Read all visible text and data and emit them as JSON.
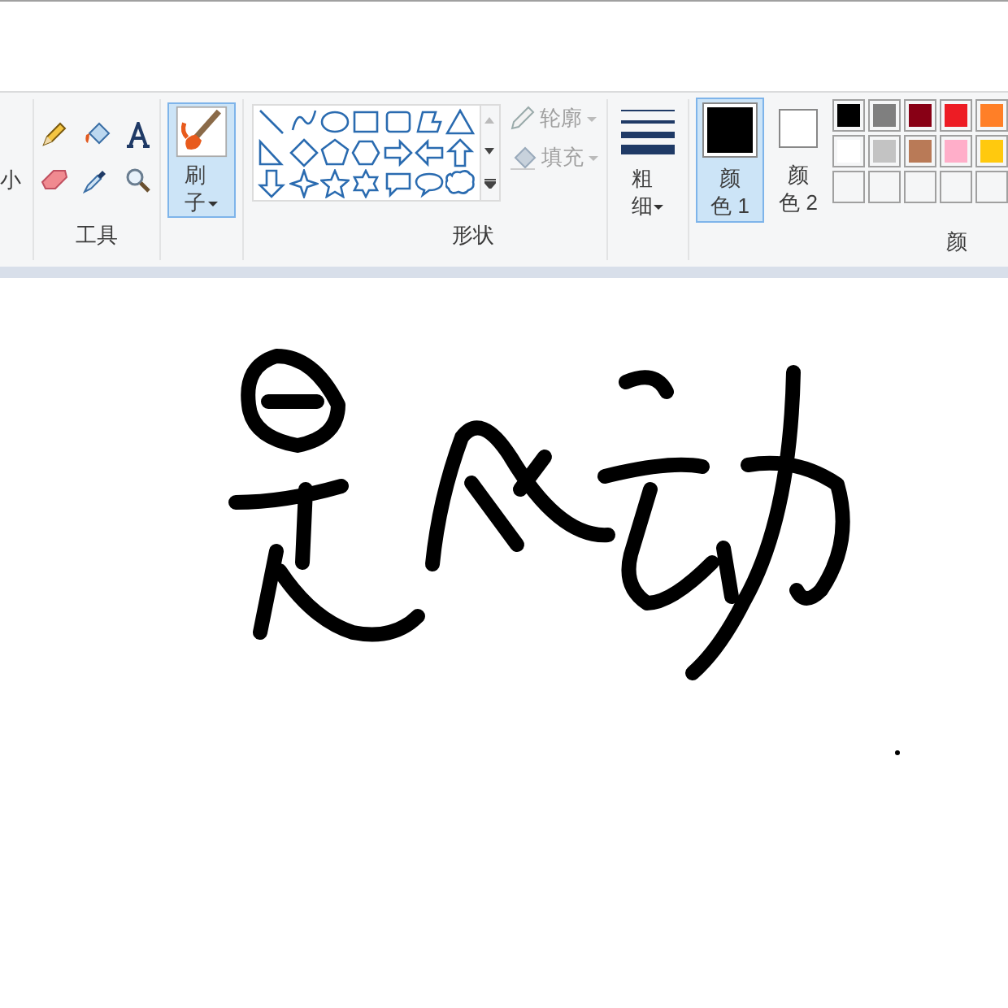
{
  "ribbon": {
    "cut_group_label": "小",
    "tools": {
      "label": "工具"
    },
    "brushes": {
      "label": "刷子",
      "selected": true
    },
    "shapes": {
      "label": "形状",
      "outline": {
        "label": "轮廓",
        "disabled": true
      },
      "fill": {
        "label": "填充",
        "disabled": true
      }
    },
    "size": {
      "label": "粗细"
    },
    "color_1": {
      "label": "颜色 1",
      "selected": true,
      "color": "#000000"
    },
    "color_2": {
      "label": "颜色 2",
      "selected": false,
      "color": "#ffffff"
    },
    "palette": [
      [
        {
          "kind": "swatch",
          "color": "#000000"
        },
        {
          "kind": "swatch",
          "color": "#7f7f7f"
        },
        {
          "kind": "swatch",
          "color": "#880015"
        },
        {
          "kind": "swatch",
          "color": "#ed1c24"
        },
        {
          "kind": "swatch",
          "color": "#ff7f27"
        }
      ],
      [
        {
          "kind": "swatch",
          "color": "#ffffff"
        },
        {
          "kind": "swatch",
          "color": "#c3c3c3"
        },
        {
          "kind": "swatch",
          "color": "#b97a57"
        },
        {
          "kind": "swatch",
          "color": "#ffaec9"
        },
        {
          "kind": "swatch",
          "color": "#ffc90e"
        }
      ],
      [
        {
          "kind": "empty"
        },
        {
          "kind": "empty"
        },
        {
          "kind": "empty"
        },
        {
          "kind": "empty"
        },
        {
          "kind": "empty"
        }
      ]
    ],
    "colors_label": "颜"
  }
}
